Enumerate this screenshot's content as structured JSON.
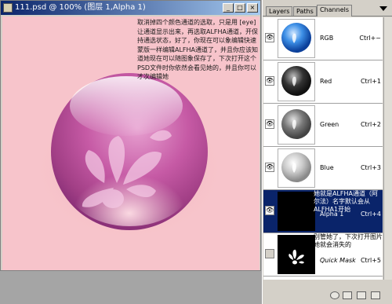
{
  "document": {
    "title": "111.psd @ 100% (图层 1,Alpha 1)",
    "note": "取消掉四个颜色通道的选取，只是用 [eye] 让通道显示出来，再选取ALFHA通道，开保持通选状态，好了，你现在可以象编辑快速蒙版一样编辑ALFHA通道了，并且你应该知道她现在可以随图象保存了，下次打开这个PSD文件时你依然会看见她的，并且你可以才次编辑她"
  },
  "panel": {
    "tabs": [
      "Layers",
      "Paths",
      "Channels"
    ],
    "active_tab": "Channels",
    "channels": [
      {
        "name": "RGB",
        "shortcut": "Ctrl+~",
        "visible": true,
        "selected": false
      },
      {
        "name": "Red",
        "shortcut": "Ctrl+1",
        "visible": true,
        "selected": false
      },
      {
        "name": "Green",
        "shortcut": "Ctrl+2",
        "visible": true,
        "selected": false
      },
      {
        "name": "Blue",
        "shortcut": "Ctrl+3",
        "visible": true,
        "selected": false
      },
      {
        "name": "Alpha 1",
        "shortcut": "Ctrl+4",
        "visible": true,
        "selected": true,
        "note": "她就是ALFHA通道（阿尔法）名字默认会从ALFHA1开始"
      },
      {
        "name": "Quick Mask",
        "shortcut": "Ctrl+5",
        "visible": false,
        "selected": false,
        "note": "别管她了，下次打开图片她就会消失的"
      }
    ]
  },
  "colors": {
    "canvas_bg": "#f7c4cb",
    "selection": "#0a246a",
    "sphere": "#c0559a"
  }
}
